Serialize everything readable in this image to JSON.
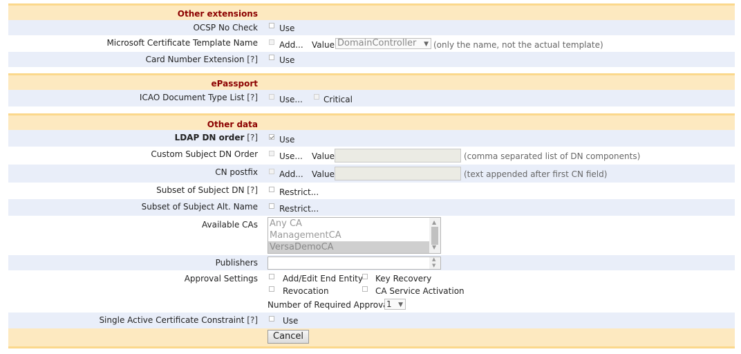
{
  "sections": {
    "other_extensions": "Other extensions",
    "epassport": "ePassport",
    "other_data": "Other data"
  },
  "help": "[?]",
  "rows": {
    "ocsp": {
      "label": "OCSP No Check",
      "cb_label": "Use"
    },
    "ms_template": {
      "label": "Microsoft Certificate Template Name",
      "cb_label": "Add...",
      "value_label": "Value",
      "select_value": "DomainController",
      "hint": "(only the name, not the actual template)"
    },
    "card_number": {
      "label": "Card Number Extension",
      "cb_label": "Use"
    },
    "icao": {
      "label": "ICAO Document Type List",
      "cb_label": "Use...",
      "critical_label": "Critical"
    },
    "ldap_dn": {
      "label": "LDAP DN order",
      "cb_label": "Use"
    },
    "custom_dn": {
      "label": "Custom Subject DN Order",
      "cb_label": "Use...",
      "value_label": "Value",
      "hint": "(comma separated list of DN components)"
    },
    "cn_postfix": {
      "label": "CN postfix",
      "cb_label": "Add...",
      "value_label": "Value",
      "hint": "(text appended after first CN field)"
    },
    "subset_dn": {
      "label": "Subset of Subject DN",
      "cb_label": "Restrict..."
    },
    "subset_alt": {
      "label": "Subset of Subject Alt. Name",
      "cb_label": "Restrict..."
    },
    "available_cas": {
      "label": "Available CAs",
      "options": [
        "Any CA",
        "ManagementCA",
        "VersaDemoCA"
      ]
    },
    "publishers": {
      "label": "Publishers"
    },
    "approval": {
      "label": "Approval Settings",
      "add_edit": "Add/Edit End Entity",
      "key_recovery": "Key Recovery",
      "revocation": "Revocation",
      "ca_activation": "CA Service Activation",
      "required_label": "Number of Required Approvals",
      "required_value": "1"
    },
    "single_active": {
      "label": "Single Active Certificate Constraint",
      "cb_label": "Use"
    }
  },
  "cancel_label": "Cancel"
}
